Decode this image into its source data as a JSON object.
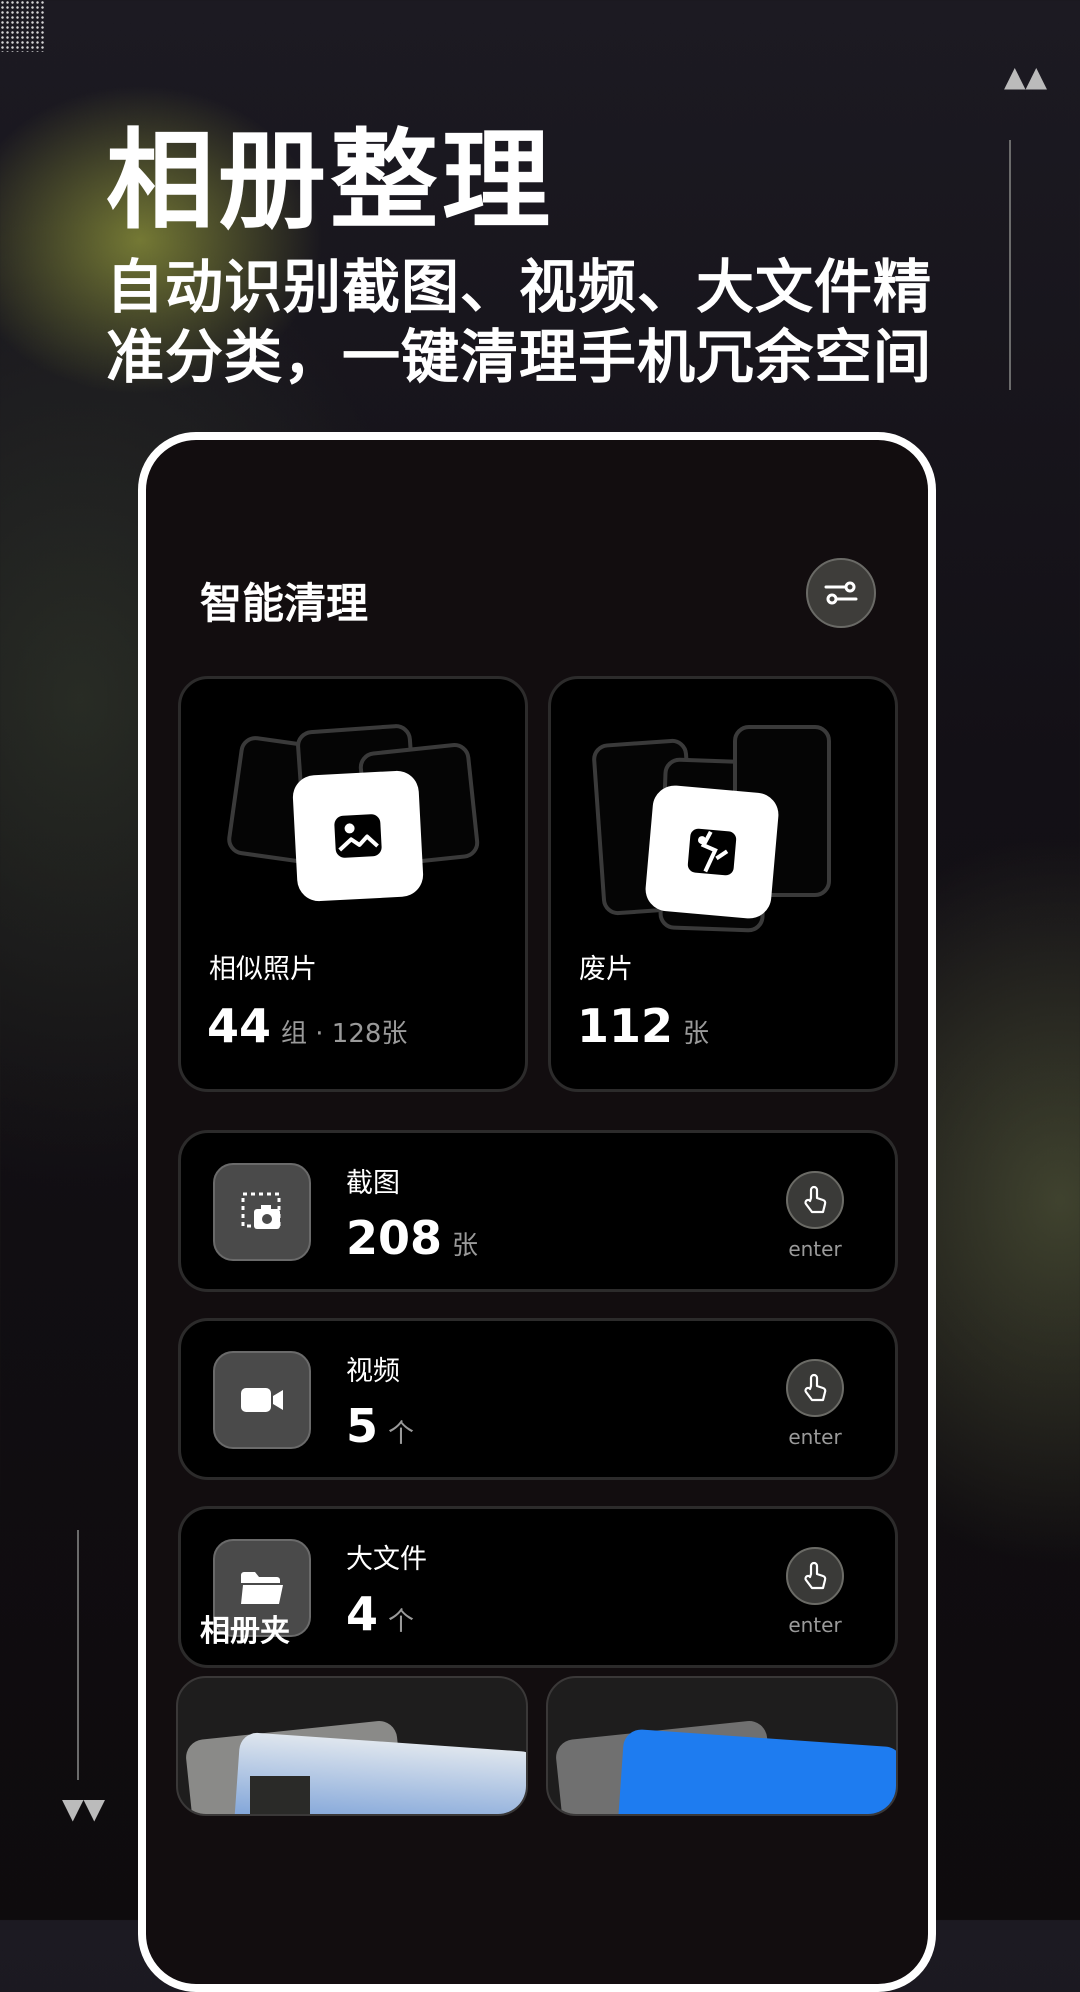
{
  "hero": {
    "title": "相册整理",
    "subtitle": "自动识别截图、视频、大文件精准分类，一键清理手机冗余空间"
  },
  "nav": {
    "up_arrows": "▲▲",
    "down_arrows": "▼▼"
  },
  "app": {
    "title": "智能清理",
    "cards": [
      {
        "label": "相似照片",
        "count": "44",
        "unit": "组 · 128张",
        "icon": "image-icon"
      },
      {
        "label": "废片",
        "count": "112",
        "unit": "张",
        "icon": "broken-image-icon"
      }
    ],
    "rows": [
      {
        "label": "截图",
        "count": "208",
        "unit": "张",
        "icon": "screenshot-icon",
        "action": "enter"
      },
      {
        "label": "视频",
        "count": "5",
        "unit": "个",
        "icon": "video-camera-icon",
        "action": "enter"
      },
      {
        "label": "大文件",
        "count": "4",
        "unit": "个",
        "icon": "folder-icon",
        "action": "enter"
      }
    ],
    "albums_title": "相册夹"
  },
  "colors": {
    "background": "#120d0f",
    "card": "#000000",
    "accent_glow": "#bec846"
  }
}
